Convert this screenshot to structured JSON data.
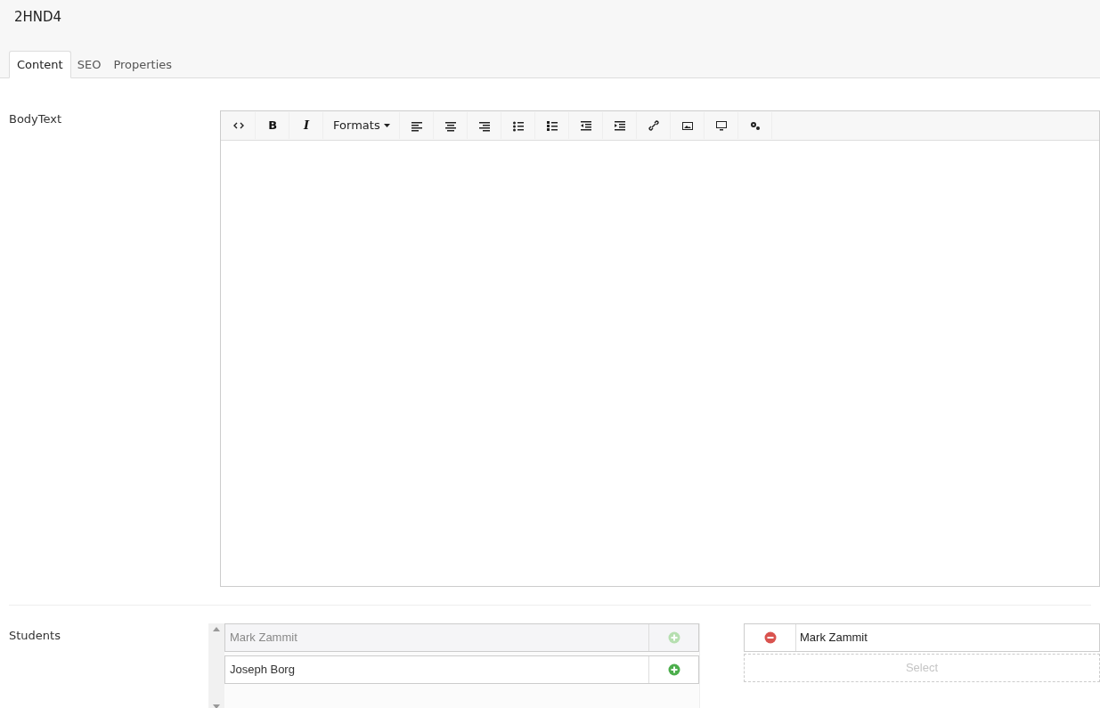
{
  "page_title": "2HND4",
  "tabs": [
    {
      "label": "Content",
      "selected": true
    },
    {
      "label": "SEO",
      "selected": false
    },
    {
      "label": "Properties",
      "selected": false
    }
  ],
  "body_text": {
    "label": "BodyText",
    "bold_button": "B",
    "italic_button": "I",
    "formats_label": "Formats"
  },
  "students": {
    "label": "Students",
    "available": [
      {
        "name": "Mark Zammit",
        "disabled": true
      },
      {
        "name": "Joseph Borg",
        "disabled": false
      }
    ],
    "selected": [
      {
        "name": "Mark Zammit"
      }
    ],
    "select_placeholder": "Select"
  }
}
